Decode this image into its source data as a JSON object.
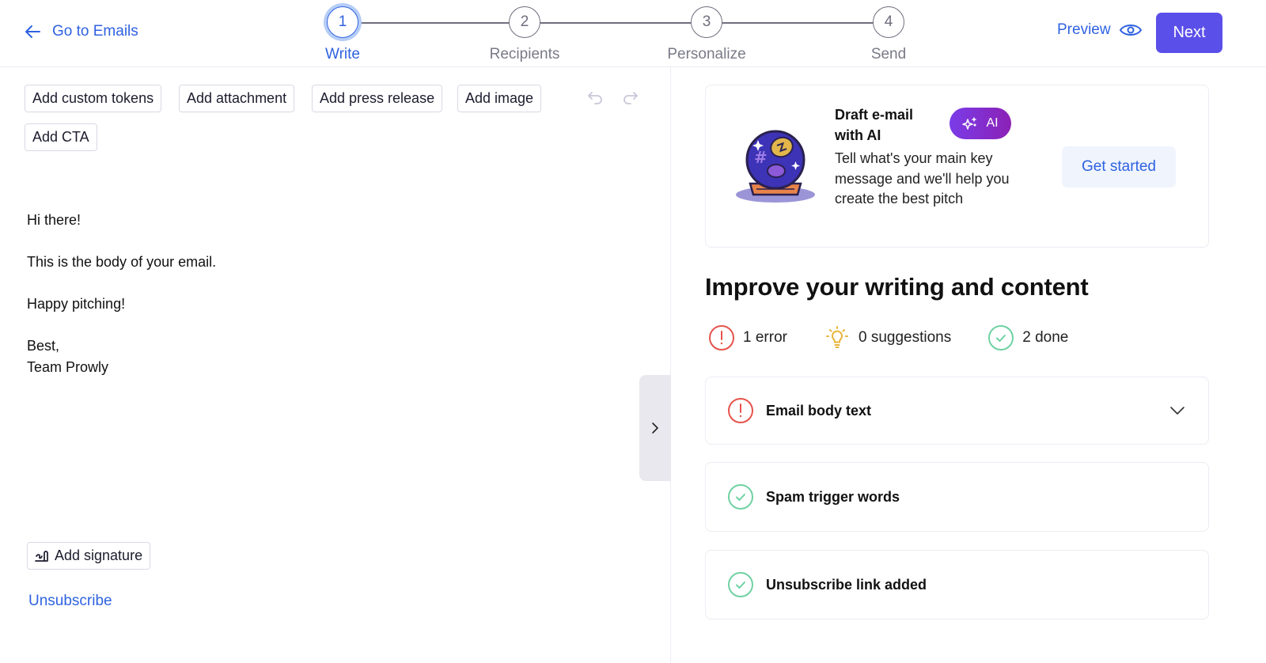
{
  "header": {
    "back_label": "Go to Emails",
    "steps": [
      {
        "number": "1",
        "label": "Write",
        "active": true
      },
      {
        "number": "2",
        "label": "Recipients",
        "active": false
      },
      {
        "number": "3",
        "label": "Personalize",
        "active": false
      },
      {
        "number": "4",
        "label": "Send",
        "active": false
      }
    ],
    "preview_label": "Preview",
    "next_label": "Next"
  },
  "editor": {
    "toolbar": {
      "custom_tokens": "Add custom tokens",
      "attachment": "Add attachment",
      "press_release": "Add press release",
      "image": "Add image",
      "cta": "Add CTA",
      "undo_icon": "undo-icon",
      "redo_icon": "redo-icon"
    },
    "body": {
      "greeting": "Hi there!",
      "line1": "This is the body of your email.",
      "line2": "Happy pitching!",
      "signoff": "Best,",
      "signer": "Team Prowly"
    },
    "signature_label": "Add signature",
    "unsubscribe_label": "Unsubscribe",
    "collapse_icon": "chevron-right-icon"
  },
  "panel": {
    "ai_card": {
      "title": "Draft e-mail with AI",
      "badge": "AI",
      "description": "Tell what's your main key message and we'll help you create the best pitch",
      "cta": "Get started"
    },
    "improve_title": "Improve your writing and content",
    "stats": {
      "errors": "1 error",
      "suggestions": "0 suggestions",
      "done": "2 done"
    },
    "checks": [
      {
        "label": "Email body text",
        "status": "error",
        "expandable": true
      },
      {
        "label": "Spam trigger words",
        "status": "done",
        "expandable": false
      },
      {
        "label": "Unsubscribe link added",
        "status": "done",
        "expandable": false
      }
    ]
  },
  "colors": {
    "accent": "#2f62e0",
    "primary_button": "#5b4fe9",
    "error": "#e5534b",
    "suggestion": "#e8b43a",
    "done": "#6fd1a3",
    "ai_gradient_start": "#7a3ce8",
    "ai_gradient_end": "#8b21b5"
  }
}
